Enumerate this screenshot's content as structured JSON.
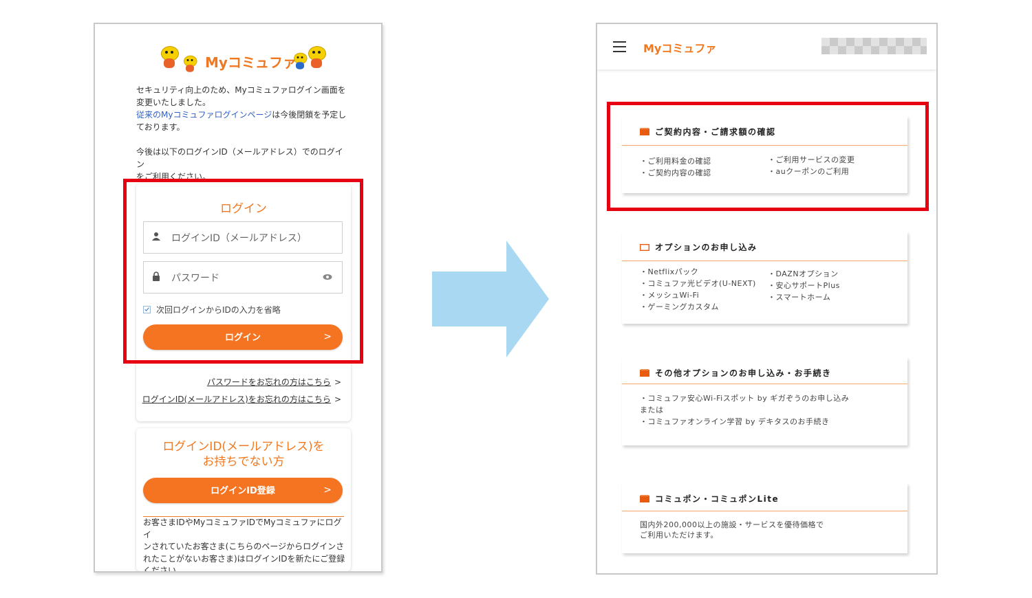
{
  "login_page": {
    "brand": "Myコミュファ",
    "notice_line1": "セキュリティ向上のため、Myコミュファログイン画面を",
    "notice_line2": "変更いたしました。",
    "notice_link": "従来のMyコミュファログインページ",
    "notice_line3": "は今後閉鎖を予定し",
    "notice_line4": "ております。",
    "notice_line5": "今後は以下のログインID（メールアドレス）でのログイン",
    "notice_line6": "をご利用ください。",
    "login_title": "ログイン",
    "login_id_placeholder": "ログインID（メールアドレス）",
    "password_placeholder": "パスワード",
    "remember_label": "次回ログインからIDの入力を省略",
    "login_button": "ログイン",
    "forgot_password": "パスワードをお忘れの方はこちら",
    "forgot_id": "ログインID(メールアドレス)をお忘れの方はこちら",
    "link_chevron": ">",
    "no_id_title_line1": "ログインID(メールアドレス)を",
    "no_id_title_line2": "お持ちでない方",
    "register_button": "ログインID登録",
    "register_note_line1": "お客さまIDやMyコミュファIDでMyコミュファにログイ",
    "register_note_line2": "ンされていたお客さま(こちらのページからログインさ",
    "register_note_line3": "れたことがないお客さま)はログインIDを新たにご登録",
    "register_note_line4": "ください。",
    "button_chevron": ">"
  },
  "menu_page": {
    "brand": "Myコミュファ",
    "cards": [
      {
        "title": "ご契約内容・ご請求額の確認",
        "left_items": [
          "・ご利用料金の確認",
          "・ご契約内容の確認"
        ],
        "right_items": [
          "・ご利用サービスの変更",
          "・auクーポンのご利用"
        ]
      },
      {
        "title": "オプションのお申し込み",
        "left_items": [
          "・Netflixパック",
          "・コミュファ光ビデオ(U-NEXT)",
          "・メッシュWi-Fi",
          "・ゲーミングカスタム"
        ],
        "right_items": [
          "・DAZNオプション",
          "・安心サポートPlus",
          "・スマートホーム"
        ]
      },
      {
        "title": "その他オプションのお申し込み・お手続き",
        "left_items": [
          "・コミュファ安心Wi-Fiスポット by ギガぞうのお申し込み",
          "または",
          "・コミュファオンライン学習 by デキタスのお手続き"
        ]
      },
      {
        "title": "コミュポン・コミュポンLite",
        "left_items": [
          "国内外200,000以上の施設・サービスを優待価格で",
          "ご利用いただけます。"
        ]
      }
    ]
  },
  "colors": {
    "accent": "#f57422",
    "highlight": "#e60012",
    "arrow": "#a9d8f2",
    "link": "#3060c8"
  }
}
